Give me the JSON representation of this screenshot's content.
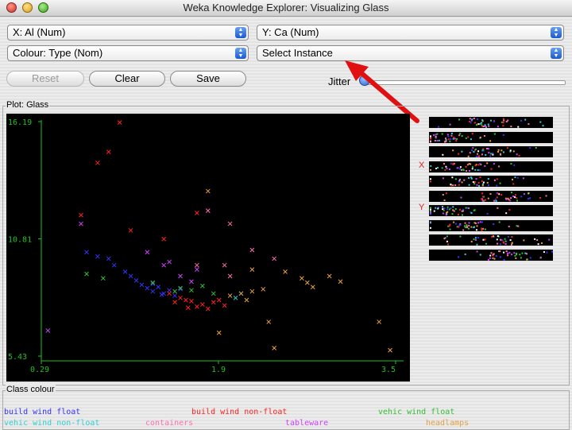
{
  "window": {
    "title": "Weka Knowledge Explorer: Visualizing Glass"
  },
  "controls": {
    "x_select": "X: Al (Num)",
    "y_select": "Y: Ca (Num)",
    "colour_select": "Colour: Type (Nom)",
    "instance_select": "Select Instance",
    "reset_label": "Reset",
    "clear_label": "Clear",
    "save_label": "Save",
    "jitter_label": "Jitter",
    "jitter_value": 0
  },
  "plot": {
    "title": "Plot: Glass"
  },
  "sidebar": {
    "x_marker": "X",
    "y_marker": "Y"
  },
  "legend": {
    "title": "Class colour",
    "classes": [
      {
        "name": "build wind float",
        "color": "#3333ff"
      },
      {
        "name": "build wind non-float",
        "color": "#ff2020"
      },
      {
        "name": "vehic wind float",
        "color": "#30c030"
      },
      {
        "name": "vehic wind non-float",
        "color": "#30d0d0"
      },
      {
        "name": "containers",
        "color": "#ff70b0"
      },
      {
        "name": "tableware",
        "color": "#d040ff"
      },
      {
        "name": "headlamps",
        "color": "#e8a040"
      }
    ]
  },
  "chart_data": {
    "type": "scatter",
    "title": "Plot: Glass",
    "xlabel": "Al",
    "ylabel": "Ca",
    "xlim": [
      0.29,
      3.5
    ],
    "ylim": [
      5.43,
      16.19
    ],
    "x_ticks": [
      "0.29",
      "1.9",
      "3.5"
    ],
    "y_ticks": [
      "16.19",
      "10.81",
      "5.43"
    ],
    "grid": false,
    "series": [
      {
        "name": "build wind float",
        "color": "#3333ff",
        "points": [
          [
            0.95,
            9.6
          ],
          [
            1.1,
            9.1
          ],
          [
            1.2,
            8.7
          ],
          [
            1.25,
            8.55
          ],
          [
            1.3,
            8.4
          ],
          [
            1.35,
            8.6
          ],
          [
            1.4,
            8.3
          ],
          [
            1.45,
            8.45
          ],
          [
            1.5,
            8.2
          ],
          [
            1.55,
            8.5
          ],
          [
            1.15,
            8.9
          ],
          [
            1.05,
            9.3
          ],
          [
            0.9,
            9.9
          ],
          [
            0.8,
            10.0
          ],
          [
            0.7,
            10.2
          ],
          [
            1.3,
            8.75
          ],
          [
            1.38,
            8.25
          ]
        ]
      },
      {
        "name": "build wind non-float",
        "color": "#ff2020",
        "points": [
          [
            1.5,
            7.9
          ],
          [
            1.6,
            8.0
          ],
          [
            1.7,
            7.7
          ],
          [
            1.75,
            7.8
          ],
          [
            1.8,
            7.6
          ],
          [
            1.65,
            7.95
          ],
          [
            1.55,
            8.1
          ],
          [
            1.85,
            7.9
          ],
          [
            1.9,
            8.0
          ],
          [
            1.45,
            8.3
          ],
          [
            1.95,
            7.75
          ],
          [
            1.0,
            16.15
          ],
          [
            0.9,
            14.8
          ],
          [
            0.8,
            14.3
          ],
          [
            1.1,
            11.2
          ],
          [
            0.65,
            11.9
          ],
          [
            1.7,
            12.0
          ],
          [
            1.4,
            10.8
          ],
          [
            1.62,
            7.65
          ]
        ]
      },
      {
        "name": "vehic wind float",
        "color": "#30c030",
        "points": [
          [
            1.55,
            8.55
          ],
          [
            1.65,
            8.45
          ],
          [
            1.75,
            8.65
          ],
          [
            1.5,
            8.4
          ],
          [
            1.85,
            8.3
          ],
          [
            1.3,
            8.8
          ],
          [
            0.85,
            9.0
          ],
          [
            0.7,
            9.2
          ]
        ]
      },
      {
        "name": "vehic wind non-float",
        "color": "#30d0d0",
        "points": [
          [
            2.05,
            8.1
          ],
          [
            2.1,
            8.3
          ]
        ]
      },
      {
        "name": "containers",
        "color": "#ff70b0",
        "points": [
          [
            1.8,
            12.1
          ],
          [
            2.0,
            11.5
          ],
          [
            2.2,
            10.3
          ],
          [
            1.7,
            9.6
          ],
          [
            2.4,
            9.9
          ],
          [
            2.0,
            9.1
          ],
          [
            1.95,
            9.6
          ]
        ]
      },
      {
        "name": "tableware",
        "color": "#d040ff",
        "points": [
          [
            1.4,
            9.6
          ],
          [
            1.7,
            9.4
          ],
          [
            1.25,
            10.2
          ],
          [
            0.35,
            6.6
          ],
          [
            0.65,
            11.5
          ],
          [
            1.55,
            9.1
          ],
          [
            1.65,
            8.85
          ],
          [
            1.45,
            9.75
          ]
        ]
      },
      {
        "name": "headlamps",
        "color": "#e8a040",
        "points": [
          [
            2.1,
            8.3
          ],
          [
            2.15,
            8.0
          ],
          [
            2.2,
            8.4
          ],
          [
            2.0,
            8.2
          ],
          [
            2.3,
            8.5
          ],
          [
            2.5,
            9.3
          ],
          [
            2.65,
            9.0
          ],
          [
            2.9,
            9.1
          ],
          [
            3.0,
            8.85
          ],
          [
            3.35,
            7.0
          ],
          [
            3.45,
            5.7
          ],
          [
            2.4,
            5.8
          ],
          [
            1.9,
            6.5
          ],
          [
            2.2,
            9.4
          ],
          [
            2.7,
            8.8
          ],
          [
            1.8,
            13.0
          ],
          [
            2.35,
            7.0
          ],
          [
            2.75,
            8.6
          ]
        ]
      }
    ]
  }
}
